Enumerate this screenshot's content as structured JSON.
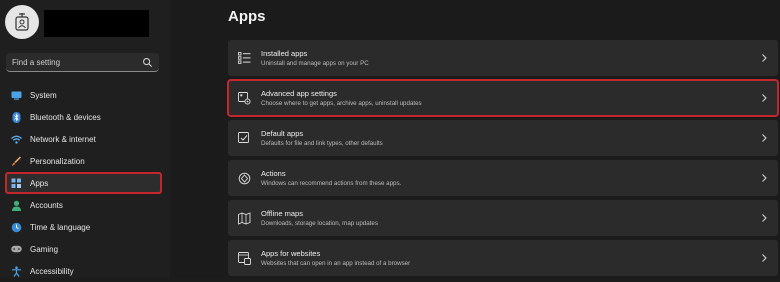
{
  "page": {
    "title": "Apps"
  },
  "user": {
    "avatar_icon": "user-badge-icon"
  },
  "search": {
    "placeholder": "Find a setting"
  },
  "sidebar": {
    "items": [
      {
        "label": "System",
        "icon": "monitor-icon",
        "active": false
      },
      {
        "label": "Bluetooth & devices",
        "icon": "bluetooth-icon",
        "active": false
      },
      {
        "label": "Network & internet",
        "icon": "wifi-icon",
        "active": false
      },
      {
        "label": "Personalization",
        "icon": "brush-icon",
        "active": false
      },
      {
        "label": "Apps",
        "icon": "apps-icon",
        "active": true
      },
      {
        "label": "Accounts",
        "icon": "person-icon",
        "active": false
      },
      {
        "label": "Time & language",
        "icon": "globe-clock-icon",
        "active": false
      },
      {
        "label": "Gaming",
        "icon": "gamepad-icon",
        "active": false
      },
      {
        "label": "Accessibility",
        "icon": "accessibility-icon",
        "active": false
      }
    ]
  },
  "main": {
    "cards": [
      {
        "title": "Installed apps",
        "subtitle": "Uninstall and manage apps on your PC",
        "icon": "list-icon"
      },
      {
        "title": "Advanced app settings",
        "subtitle": "Choose where to get apps, archive apps, uninstall updates",
        "icon": "app-settings-icon",
        "highlighted": true
      },
      {
        "title": "Default apps",
        "subtitle": "Defaults for file and link types, other defaults",
        "icon": "default-apps-icon"
      },
      {
        "title": "Actions",
        "subtitle": "Windows can recommend actions from these apps.",
        "icon": "actions-icon"
      },
      {
        "title": "Offline maps",
        "subtitle": "Downloads, storage location, map updates",
        "icon": "map-icon"
      },
      {
        "title": "Apps for websites",
        "subtitle": "Websites that can open in an app instead of a browser",
        "icon": "web-apps-icon"
      }
    ]
  },
  "colors": {
    "accent_highlight": "#c4262e",
    "background": "#1c1c1c",
    "card": "#2b2b2b"
  }
}
